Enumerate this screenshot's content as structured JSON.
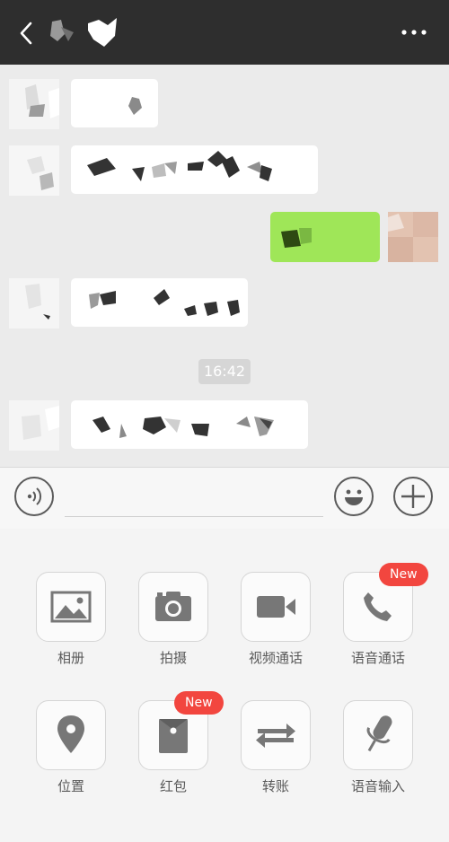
{
  "header": {
    "back_icon": "chevron-left-icon",
    "more_icon": "more-dots-icon"
  },
  "chat": {
    "timestamp": "16:42"
  },
  "input_bar": {
    "voice_icon": "voice-icon",
    "emoji_icon": "emoji-icon",
    "plus_icon": "plus-icon"
  },
  "panel": {
    "items": [
      {
        "label": "相册",
        "icon": "image-icon"
      },
      {
        "label": "拍摄",
        "icon": "camera-icon"
      },
      {
        "label": "视频通话",
        "icon": "video-icon"
      },
      {
        "label": "语音通话",
        "icon": "phone-icon",
        "badge": "New"
      },
      {
        "label": "位置",
        "icon": "location-icon"
      },
      {
        "label": "红包",
        "icon": "red-packet-icon",
        "badge": "New"
      },
      {
        "label": "转账",
        "icon": "transfer-icon"
      },
      {
        "label": "语音输入",
        "icon": "microphone-icon"
      }
    ]
  },
  "colors": {
    "header_bg": "#2e2e2e",
    "sent_bubble": "#9fe658",
    "badge": "#f2463f",
    "icon_gray": "#777777"
  }
}
